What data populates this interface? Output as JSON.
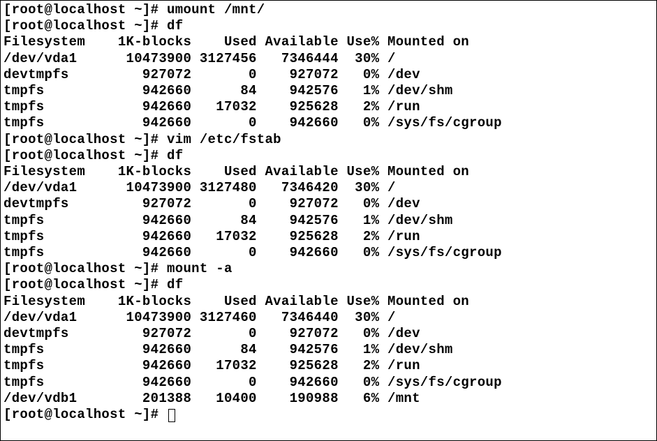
{
  "prompt": {
    "user": "root",
    "host": "localhost",
    "cwd": "~",
    "symbol": "#"
  },
  "commands": {
    "umount": "umount /mnt/",
    "df": "df",
    "vim": "vim /etc/fstab",
    "mount_a": "mount -a"
  },
  "df_header": {
    "fs": "Filesystem",
    "blocks": "1K-blocks",
    "used": "Used",
    "avail": "Available",
    "usep": "Use%",
    "mount": "Mounted on"
  },
  "df1": [
    {
      "fs": "/dev/vda1",
      "blocks": "10473900",
      "used": "3127456",
      "avail": "7346444",
      "usep": "30%",
      "mount": "/"
    },
    {
      "fs": "devtmpfs",
      "blocks": "927072",
      "used": "0",
      "avail": "927072",
      "usep": "0%",
      "mount": "/dev"
    },
    {
      "fs": "tmpfs",
      "blocks": "942660",
      "used": "84",
      "avail": "942576",
      "usep": "1%",
      "mount": "/dev/shm"
    },
    {
      "fs": "tmpfs",
      "blocks": "942660",
      "used": "17032",
      "avail": "925628",
      "usep": "2%",
      "mount": "/run"
    },
    {
      "fs": "tmpfs",
      "blocks": "942660",
      "used": "0",
      "avail": "942660",
      "usep": "0%",
      "mount": "/sys/fs/cgroup"
    }
  ],
  "df2": [
    {
      "fs": "/dev/vda1",
      "blocks": "10473900",
      "used": "3127480",
      "avail": "7346420",
      "usep": "30%",
      "mount": "/"
    },
    {
      "fs": "devtmpfs",
      "blocks": "927072",
      "used": "0",
      "avail": "927072",
      "usep": "0%",
      "mount": "/dev"
    },
    {
      "fs": "tmpfs",
      "blocks": "942660",
      "used": "84",
      "avail": "942576",
      "usep": "1%",
      "mount": "/dev/shm"
    },
    {
      "fs": "tmpfs",
      "blocks": "942660",
      "used": "17032",
      "avail": "925628",
      "usep": "2%",
      "mount": "/run"
    },
    {
      "fs": "tmpfs",
      "blocks": "942660",
      "used": "0",
      "avail": "942660",
      "usep": "0%",
      "mount": "/sys/fs/cgroup"
    }
  ],
  "df3": [
    {
      "fs": "/dev/vda1",
      "blocks": "10473900",
      "used": "3127460",
      "avail": "7346440",
      "usep": "30%",
      "mount": "/"
    },
    {
      "fs": "devtmpfs",
      "blocks": "927072",
      "used": "0",
      "avail": "927072",
      "usep": "0%",
      "mount": "/dev"
    },
    {
      "fs": "tmpfs",
      "blocks": "942660",
      "used": "84",
      "avail": "942576",
      "usep": "1%",
      "mount": "/dev/shm"
    },
    {
      "fs": "tmpfs",
      "blocks": "942660",
      "used": "17032",
      "avail": "925628",
      "usep": "2%",
      "mount": "/run"
    },
    {
      "fs": "tmpfs",
      "blocks": "942660",
      "used": "0",
      "avail": "942660",
      "usep": "0%",
      "mount": "/sys/fs/cgroup"
    },
    {
      "fs": "/dev/vdb1",
      "blocks": "201388",
      "used": "10400",
      "avail": "190988",
      "usep": "6%",
      "mount": "/mnt"
    }
  ]
}
